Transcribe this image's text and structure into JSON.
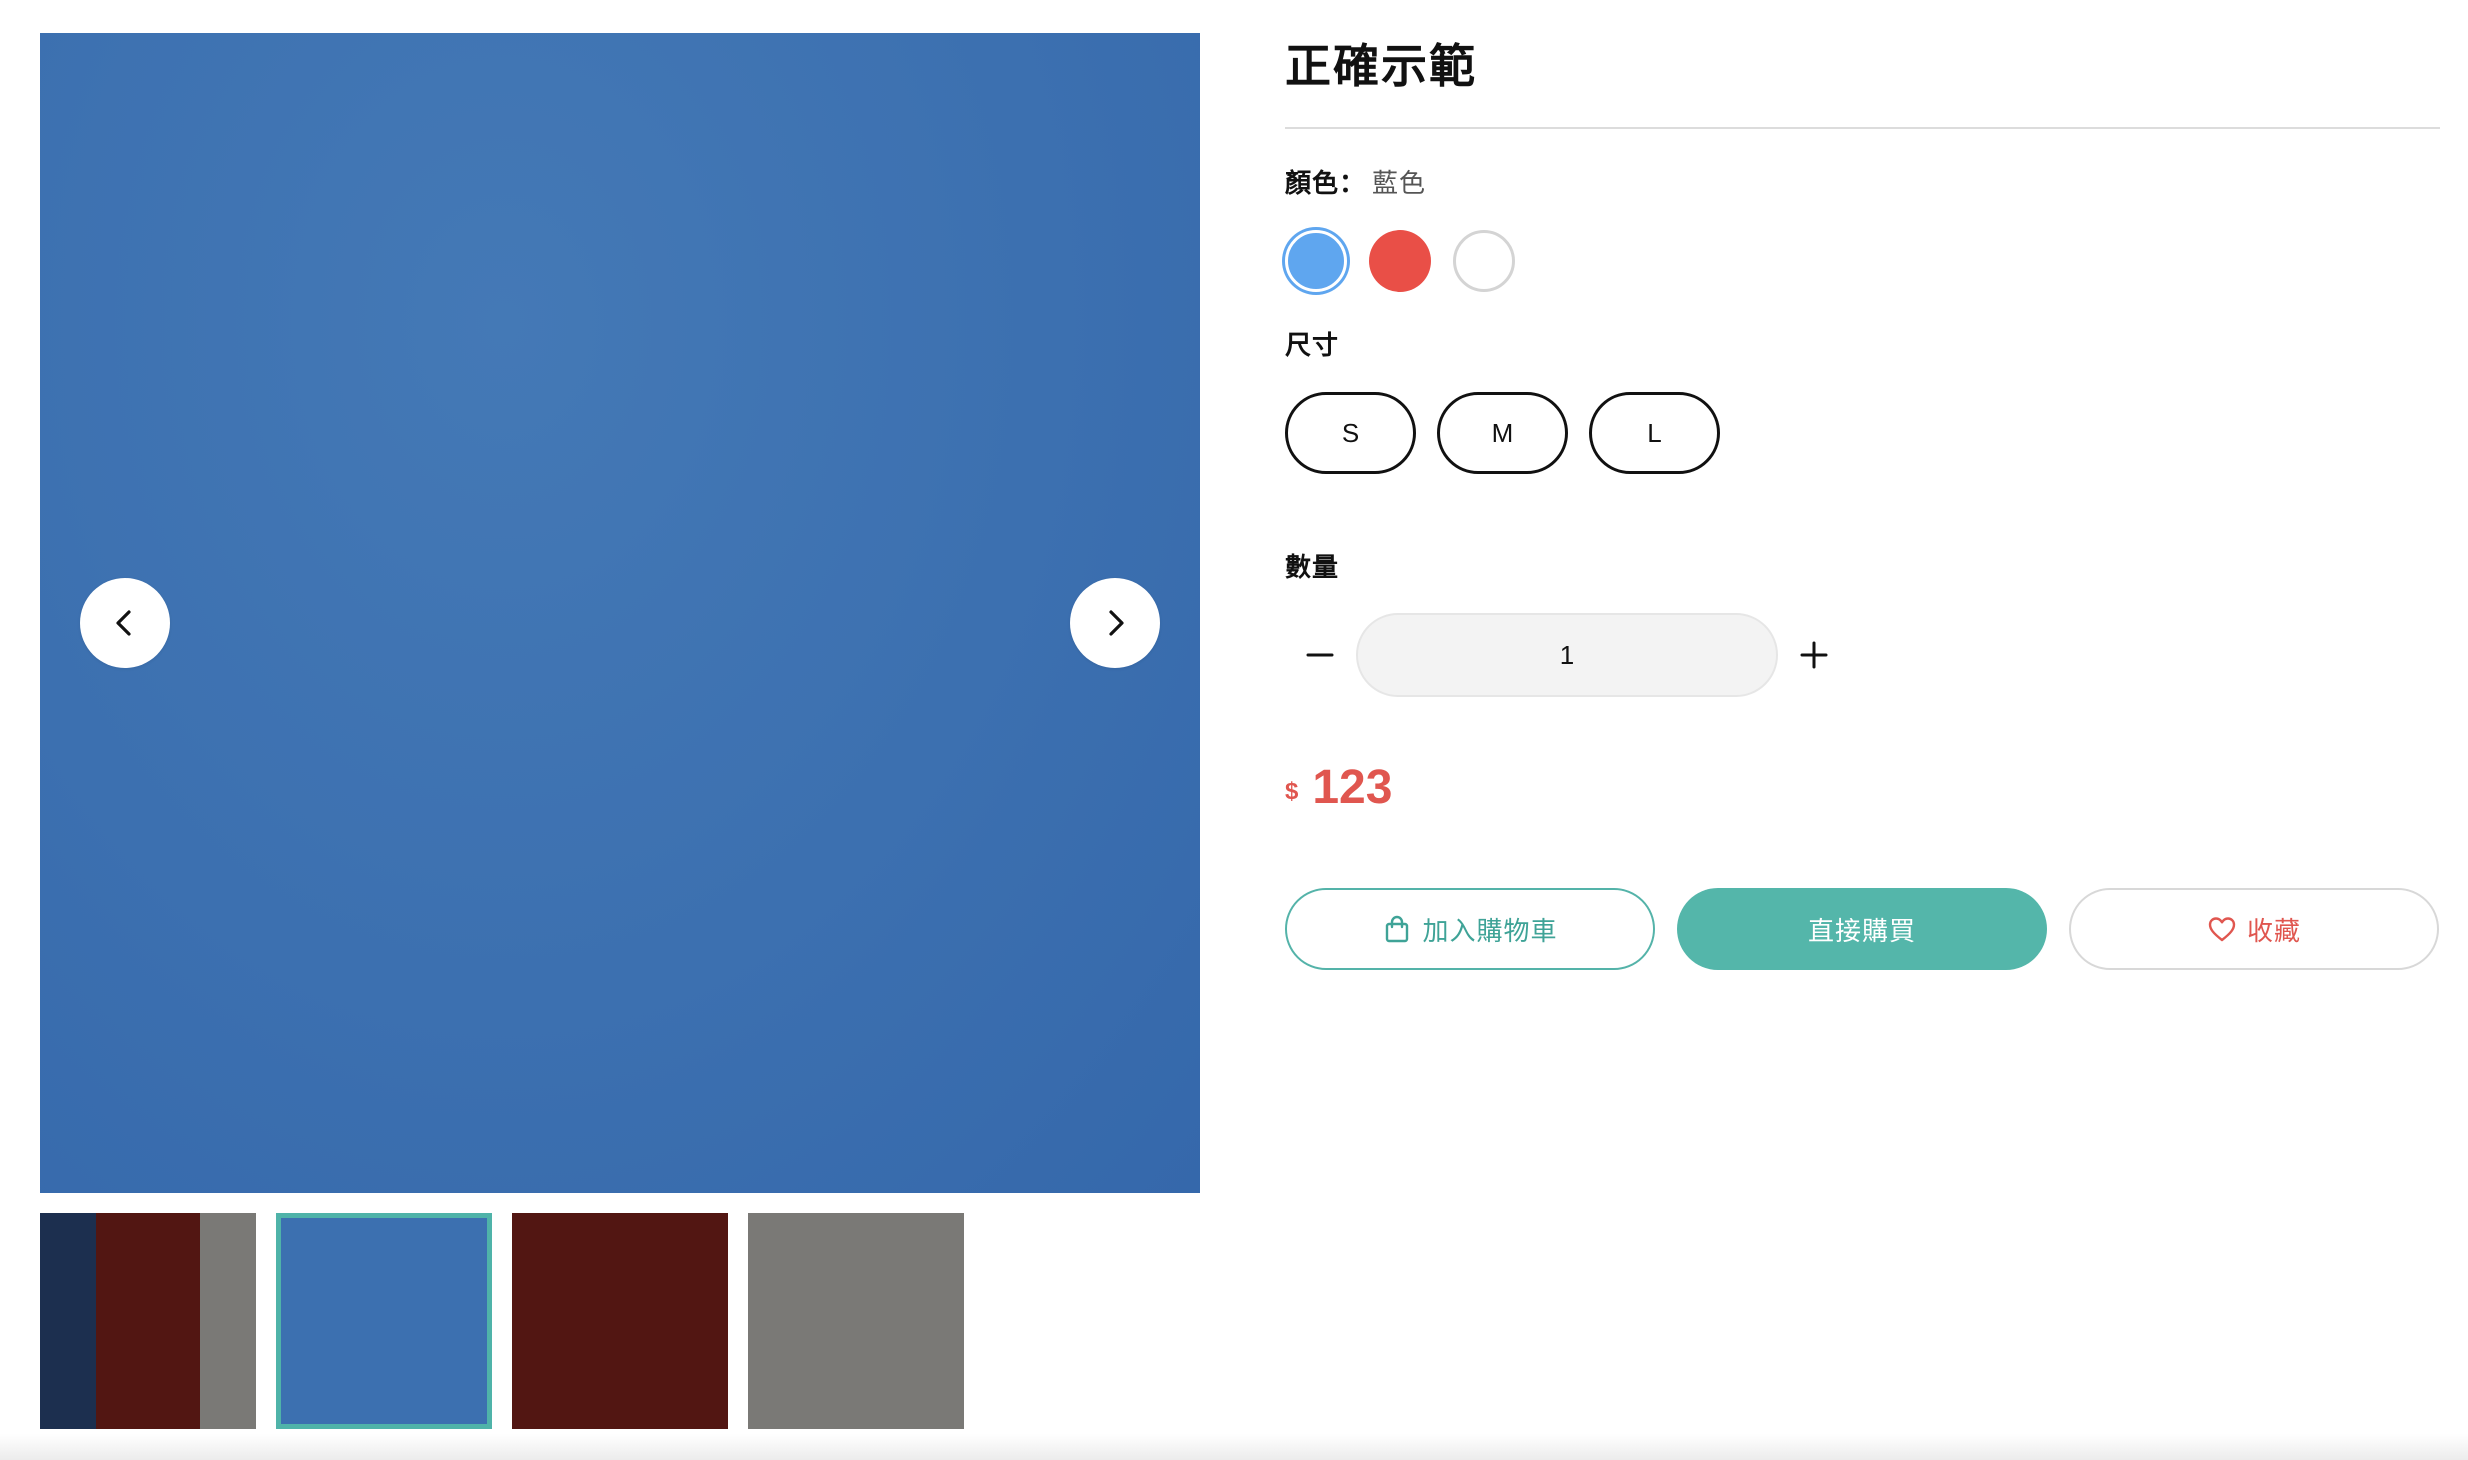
{
  "product": {
    "title": "正確示範",
    "color_label": "顏色：",
    "color_value": "藍色",
    "size_label": "尺寸",
    "quantity_label": "數量",
    "quantity_value": "1",
    "currency": "$",
    "price": "123"
  },
  "colors": [
    {
      "name": "blue",
      "hex": "#5fa6ef",
      "selected": true
    },
    {
      "name": "red",
      "hex": "#e94f47",
      "selected": false
    },
    {
      "name": "white",
      "hex": "#ffffff",
      "selected": false
    }
  ],
  "sizes": [
    "S",
    "M",
    "L"
  ],
  "gallery": {
    "main_image_color": "#3c70b0",
    "selected_thumbnail": 2,
    "thumbnails": [
      {
        "colors": [
          "#1c2f4f",
          "#521612",
          "#7a7976"
        ]
      },
      {
        "colors": [
          "#3c70b0"
        ]
      },
      {
        "colors": [
          "#521612"
        ]
      },
      {
        "colors": [
          "#7a7976"
        ]
      }
    ],
    "prev_icon": "chevron-left-icon",
    "next_icon": "chevron-right-icon"
  },
  "actions": {
    "add_to_cart": "加入購物車",
    "buy_now": "直接購買",
    "favorite": "收藏",
    "cart_icon": "shopping-bag-icon",
    "favorite_icon": "heart-icon"
  },
  "theme": {
    "accent": "#54b6aa",
    "price_color": "#e0564f"
  }
}
